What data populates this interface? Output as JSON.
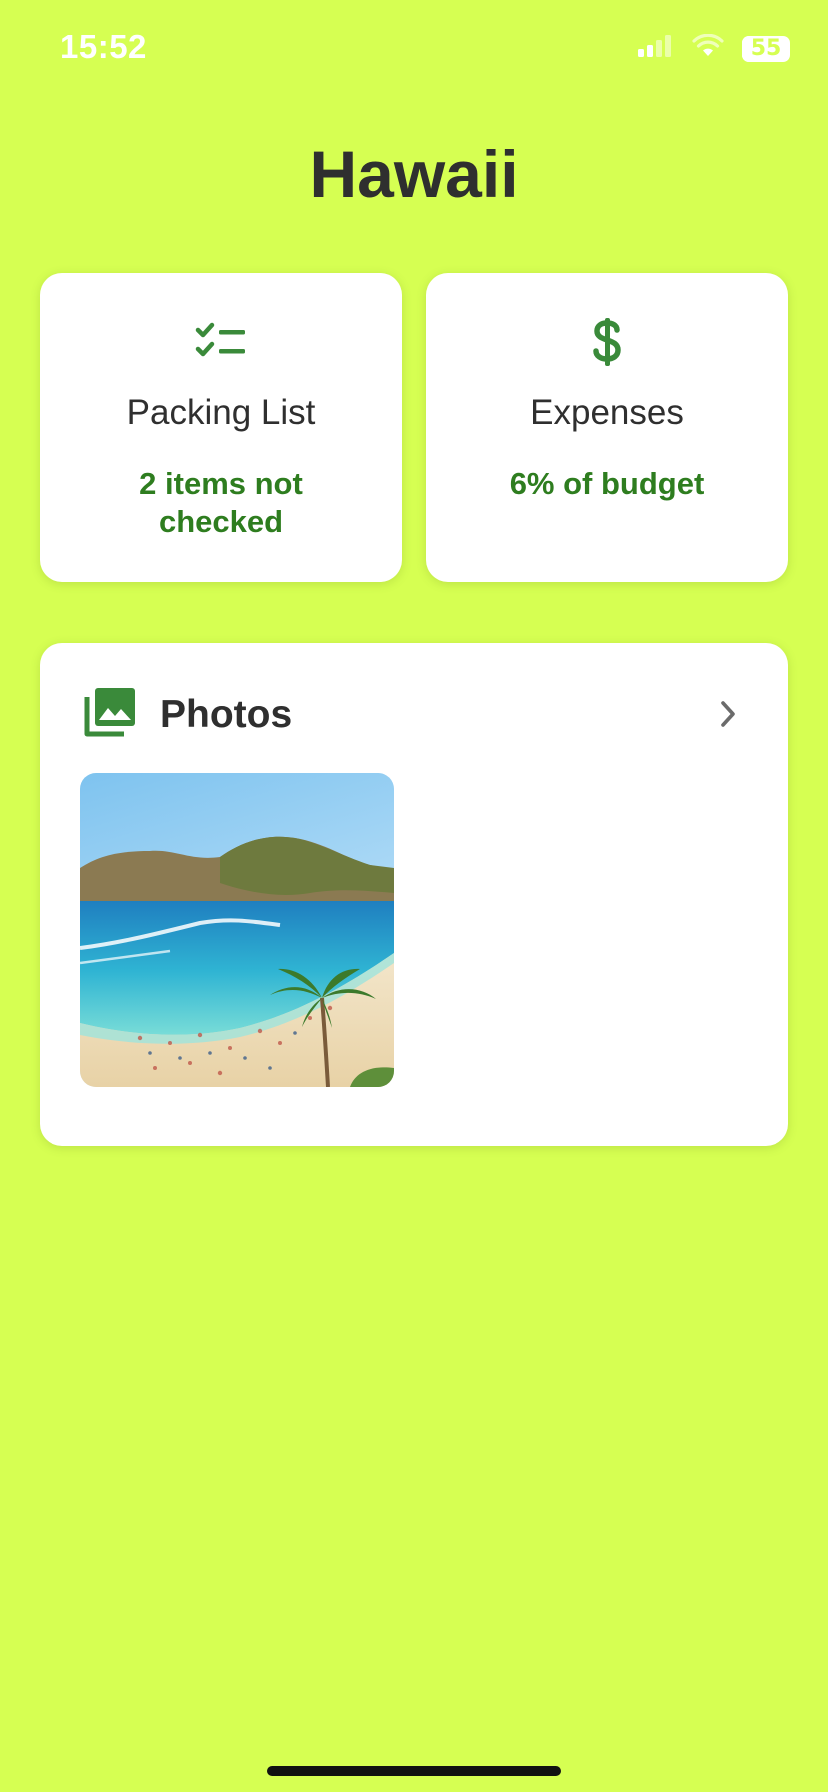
{
  "status_bar": {
    "time": "15:52",
    "battery_level": 55,
    "battery_text": "55"
  },
  "title": "Hawaii",
  "packing_card": {
    "icon": "checklist-icon",
    "title": "Packing List",
    "subtitle": "2 items not checked"
  },
  "expenses_card": {
    "icon": "dollar-icon",
    "title": "Expenses",
    "subtitle": "6% of budget"
  },
  "photos_card": {
    "icon": "photo-library-icon",
    "title": "Photos",
    "photo_count": 1
  },
  "colors": {
    "background": "#d6ff52",
    "accent_green": "#2e7d1f",
    "icon_green": "#3a8a3a",
    "text_dark": "#2f2f2f",
    "card": "#ffffff"
  }
}
